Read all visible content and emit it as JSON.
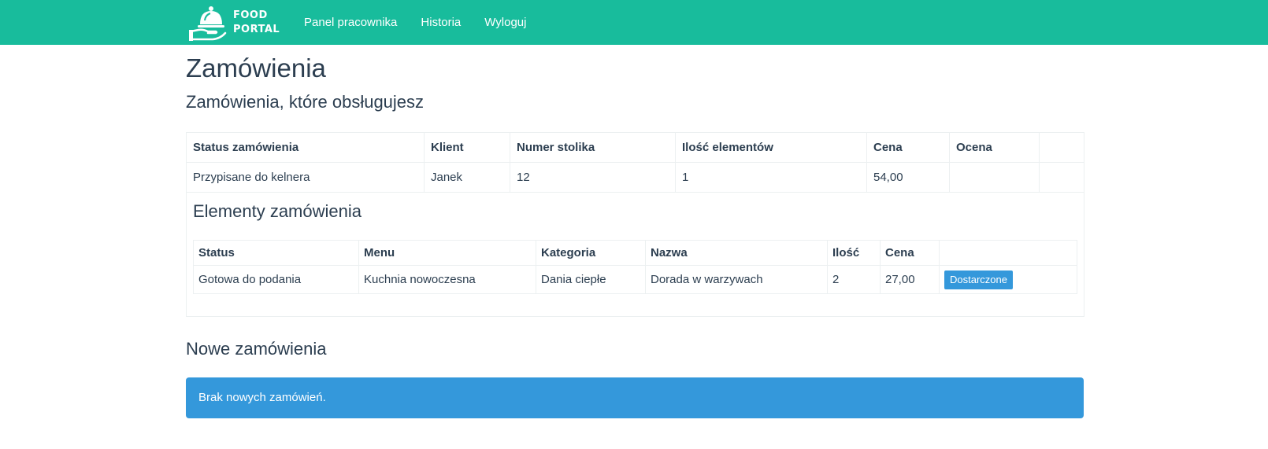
{
  "navbar": {
    "brand_line1": "FOOD",
    "brand_line2": "PORTAL",
    "brand_icon": "cloche-serving-icon",
    "links": [
      "Panel pracownika",
      "Historia",
      "Wyloguj"
    ],
    "bg_color": "#18bc9c"
  },
  "page": {
    "title": "Zamówienia",
    "subtitle": "Zamówienia, które obsługujesz"
  },
  "orders_table": {
    "headers": [
      "Status zamówienia",
      "Klient",
      "Numer stolika",
      "Ilość elementów",
      "Cena",
      "Ocena",
      ""
    ],
    "rows": [
      {
        "status": "Przypisane do kelnera",
        "client": "Janek",
        "table_number": "12",
        "item_count": "1",
        "price": "54,00",
        "rating": "",
        "extra": ""
      }
    ]
  },
  "order_items": {
    "title": "Elementy zamówienia",
    "headers": [
      "Status",
      "Menu",
      "Kategoria",
      "Nazwa",
      "Ilość",
      "Cena",
      ""
    ],
    "rows": [
      {
        "status": "Gotowa do podania",
        "menu": "Kuchnia nowoczesna",
        "category": "Dania ciepłe",
        "name": "Dorada w warzywach",
        "quantity": "2",
        "price": "27,00",
        "action_label": "Dostarczone"
      }
    ]
  },
  "new_orders": {
    "title": "Nowe zamówienia",
    "empty_message": "Brak nowych zamówień."
  },
  "colors": {
    "primary": "#3498db",
    "success": "#18bc9c",
    "text": "#2c3e50",
    "border": "#ecf0f1"
  }
}
